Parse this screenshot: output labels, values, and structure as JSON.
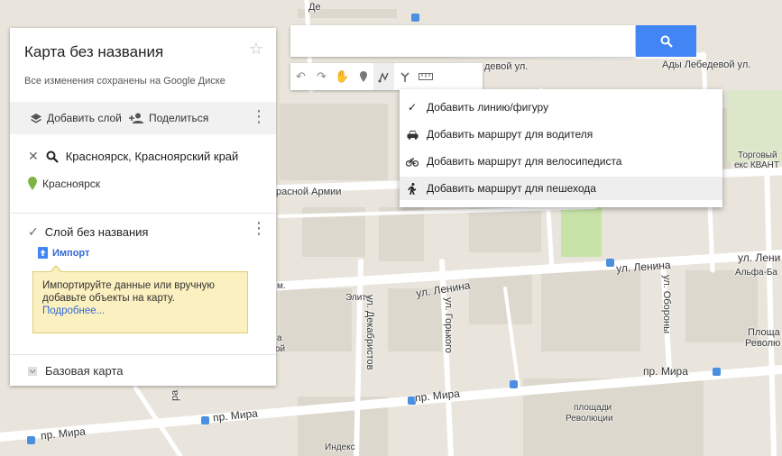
{
  "panel": {
    "title": "Карта без названия",
    "subtitle": "Все изменения сохранены на Google Диске",
    "add_layer": "Добавить слой",
    "share": "Поделиться",
    "search_query": "Красноярск, Красноярский край",
    "result": "Красноярск",
    "layer_name": "Слой без названия",
    "import": "Импорт",
    "tip_text": "Импортируйте данные или вручную добавьте объекты на карту.",
    "tip_link": "Подробнее...",
    "base_map": "Базовая карта"
  },
  "search": {
    "placeholder": ""
  },
  "dropdown": {
    "items": [
      {
        "label": "Добавить линию/фигуру",
        "icon": "check-icon"
      },
      {
        "label": "Добавить маршрут для водителя",
        "icon": "car-icon"
      },
      {
        "label": "Добавить маршрут для велосипедиста",
        "icon": "bicycle-icon"
      },
      {
        "label": "Добавить маршрут для пешехода",
        "icon": "walking-icon"
      }
    ]
  },
  "map_labels": {
    "lebedevoy": "Ады Лебедевой ул.",
    "lebedevoy_short": "девой ул.",
    "krasnoy_armii": "расной Армии",
    "lenina1": "ул. Ленина",
    "lenina2": "ул. Ленина",
    "lenina3": "ул. Лени",
    "alfa": "Альфа-Ба",
    "torgovy": "Торговый",
    "kvant": "екс КВАНТ",
    "elita": "Элита",
    "dekabristov": "ул. Декабристов",
    "gorkogo": "ул. Горького",
    "oborony": "ул. Обороны",
    "mira1": "пр. Мира",
    "mira2": "пр. Мира",
    "mira3": "пр. Мира",
    "mira4": "пр. Мира",
    "ploshadi": "площади",
    "revolyucii": "Революции",
    "ploshad_right": "Площа",
    "revolyu_right": "Револю",
    "indeks": "Индекс",
    "de": "Де",
    "ra": "ра",
    "a_label": "а",
    "oy_label": "ой",
    "m_label": "м."
  },
  "colors": {
    "accent": "#4285f4",
    "tip_bg": "#fbf0bf",
    "result_pin": "#7cb342"
  }
}
